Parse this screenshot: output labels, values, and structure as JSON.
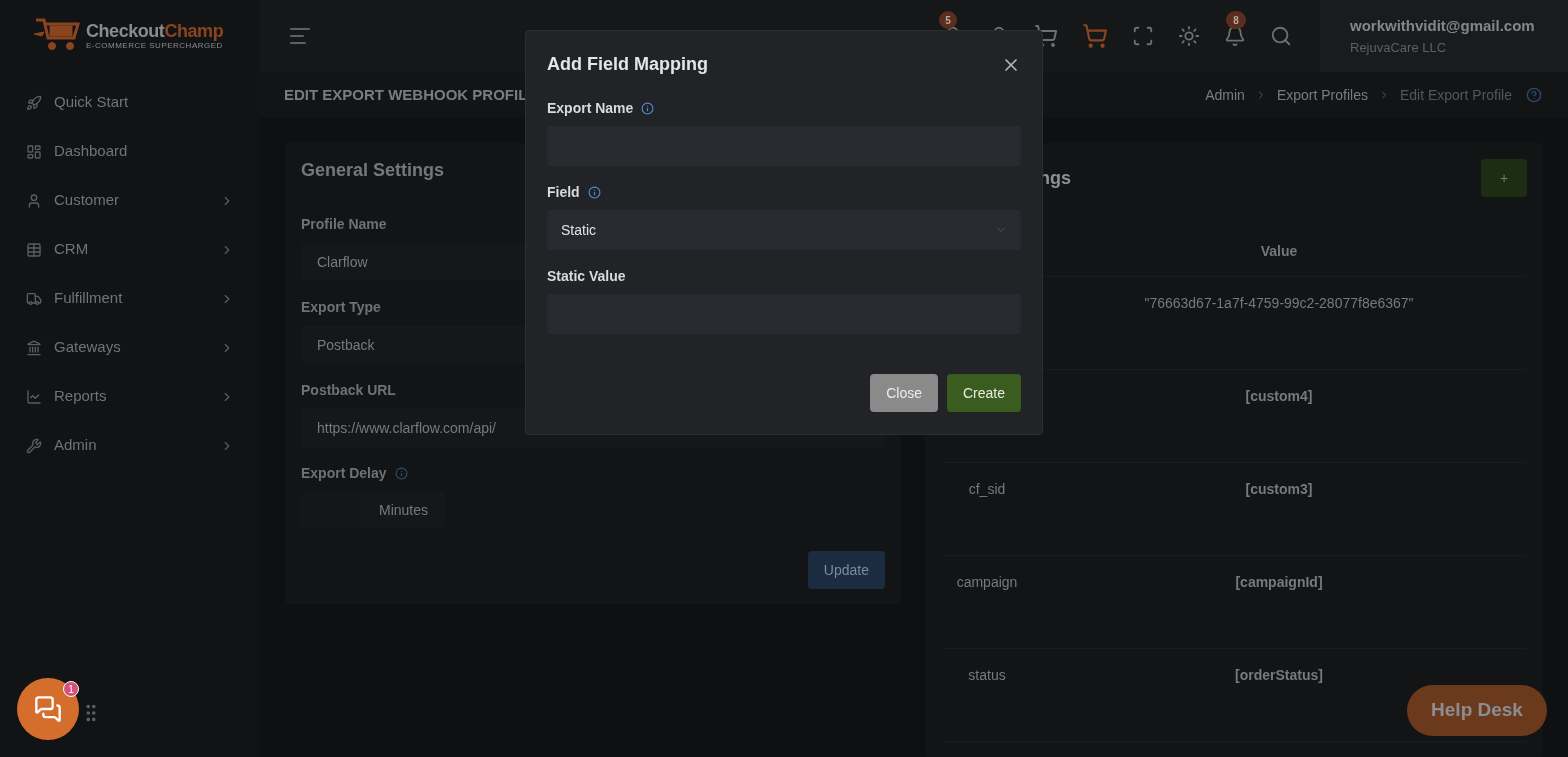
{
  "brand": {
    "name_first": "Checkout",
    "name_second": "Champ",
    "tagline": "E-COMMERCE SUPERCHARGED"
  },
  "sidebar": {
    "items": [
      {
        "label": "Quick Start",
        "expandable": false
      },
      {
        "label": "Dashboard",
        "expandable": false
      },
      {
        "label": "Customer",
        "expandable": true
      },
      {
        "label": "CRM",
        "expandable": true
      },
      {
        "label": "Fulfillment",
        "expandable": true
      },
      {
        "label": "Gateways",
        "expandable": true
      },
      {
        "label": "Reports",
        "expandable": true
      },
      {
        "label": "Admin",
        "expandable": true
      }
    ]
  },
  "header": {
    "badges": [
      "5",
      "8"
    ],
    "user": {
      "email": "workwithvidit@gmail.com",
      "company": "RejuvaCare LLC"
    }
  },
  "page_title": "EDIT EXPORT WEBHOOK PROFIL",
  "breadcrumbs": [
    {
      "label": "Admin",
      "current": false
    },
    {
      "label": "Export Profiles",
      "current": false
    },
    {
      "label": "Edit Export Profile",
      "current": true
    }
  ],
  "general_settings": {
    "title": "General Settings",
    "fields": [
      {
        "label": "Profile Name",
        "kind": "input",
        "value": "Clarflow",
        "info": false
      },
      {
        "label": "Export Type",
        "kind": "input",
        "value": "Postback",
        "info": false
      },
      {
        "label": "Postback URL",
        "kind": "input",
        "value": "https://www.clarflow.com/api/",
        "info": false
      },
      {
        "label": "Export Delay",
        "kind": "delay",
        "value": "Minutes",
        "info": true
      }
    ],
    "button": "Update"
  },
  "mappings": {
    "title": "ngs",
    "add_button": "+",
    "columns": [
      "Value"
    ],
    "rows": [
      {
        "value": "\"76663d67-1a7f-4759-99c2-28077f8e6367\"",
        "bold": false
      },
      {
        "value": "[custom4]",
        "bold": true
      },
      {
        "key": "cf_sid",
        "value": "[custom3]",
        "bold": true
      },
      {
        "key": "campaign",
        "value": "[campaignId]",
        "bold": true
      },
      {
        "key": "status",
        "value": "[orderStatus]",
        "bold": true
      }
    ]
  },
  "modal": {
    "title": "Add Field Mapping",
    "fields": [
      {
        "label": "Export Name",
        "kind": "input",
        "info": true
      },
      {
        "label": "Field",
        "kind": "select",
        "value": "Static",
        "info": true
      },
      {
        "label": "Static Value",
        "kind": "input",
        "info": false
      }
    ],
    "buttons": [
      {
        "label": "Close",
        "kind": "secondary"
      },
      {
        "label": "Create",
        "kind": "primary"
      }
    ]
  },
  "chat": {
    "badge": "1"
  },
  "help_desk": "Help Desk"
}
